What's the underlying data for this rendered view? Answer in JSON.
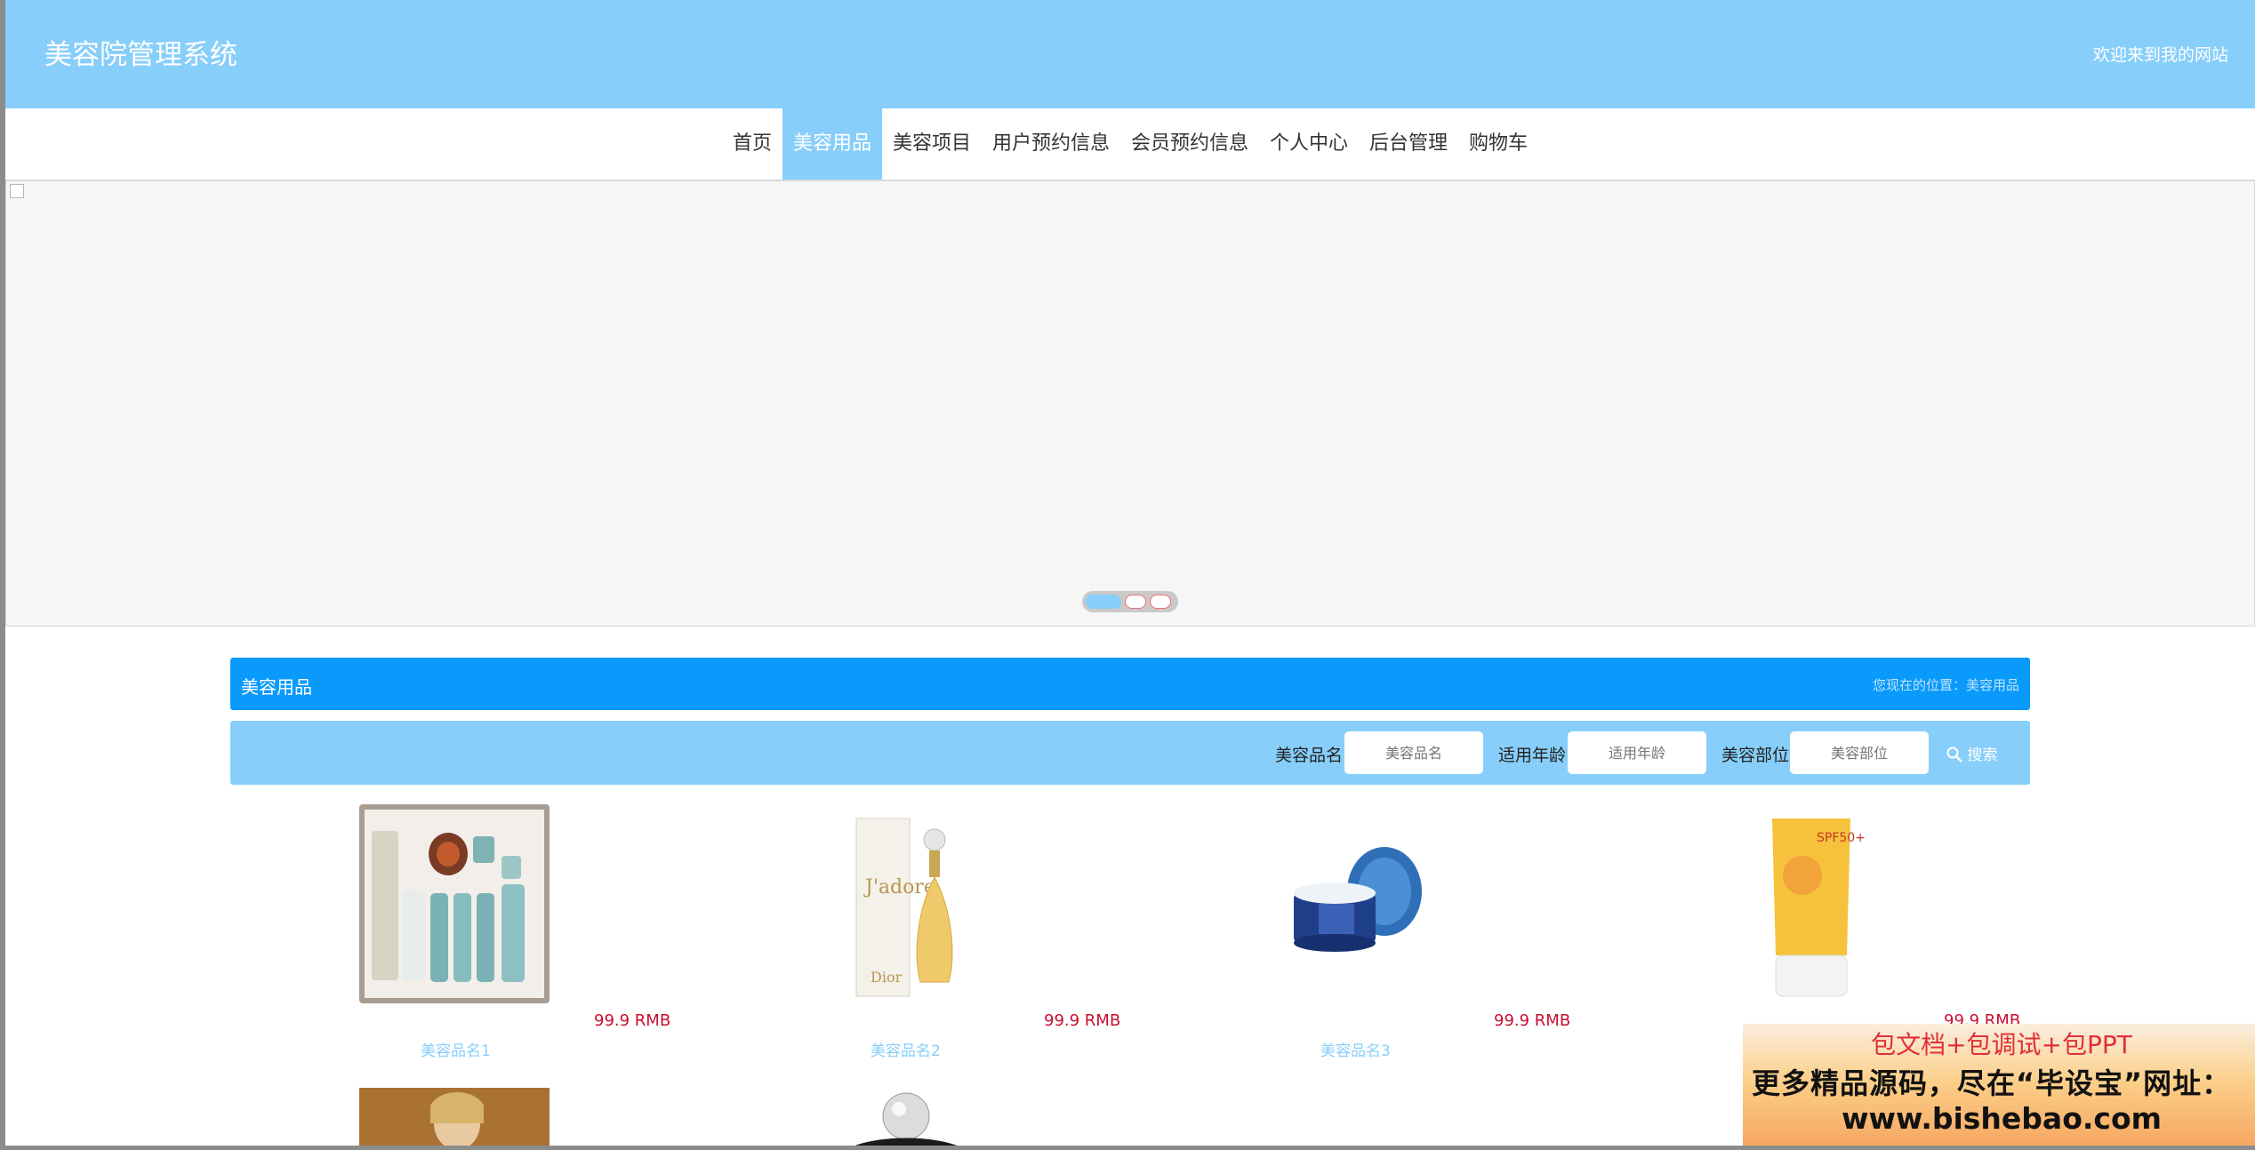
{
  "header": {
    "title": "美容院管理系统",
    "welcome": "欢迎来到我的网站"
  },
  "nav": {
    "items": [
      {
        "label": "首页",
        "active": false
      },
      {
        "label": "美容用品",
        "active": true
      },
      {
        "label": "美容项目",
        "active": false
      },
      {
        "label": "用户预约信息",
        "active": false
      },
      {
        "label": "会员预约信息",
        "active": false
      },
      {
        "label": "个人中心",
        "active": false
      },
      {
        "label": "后台管理",
        "active": false
      },
      {
        "label": "购物车",
        "active": false
      }
    ]
  },
  "carousel": {
    "slide_count": 3,
    "active_index": 0
  },
  "section": {
    "title": "美容用品",
    "breadcrumb": "您现在的位置：美容用品"
  },
  "search": {
    "name_label": "美容品名",
    "name_placeholder": "美容品名",
    "age_label": "适用年龄",
    "age_placeholder": "适用年龄",
    "part_label": "美容部位",
    "part_placeholder": "美容部位",
    "button_label": "搜索",
    "button_icon": "search-icon"
  },
  "products": [
    {
      "name": "美容品名1",
      "price": "99.9 RMB",
      "image": "skincare-set-image"
    },
    {
      "name": "美容品名2",
      "price": "99.9 RMB",
      "image": "perfume-bottle-image"
    },
    {
      "name": "美容品名3",
      "price": "99.9 RMB",
      "image": "cream-jar-image"
    },
    {
      "name": "",
      "price": "99.9 RMB",
      "image": "sunscreen-tube-image"
    }
  ],
  "more_products": [
    {
      "image": "portrait-product-image"
    },
    {
      "image": "crystal-bottle-image"
    }
  ],
  "ad": {
    "line1": "包文档+包调试+包PPT",
    "line2": "更多精品源码，尽在“毕设宝”网址：",
    "line3": "www.bishebao.com"
  },
  "colors": {
    "header_bg": "#87cefa",
    "section_bar": "#0a9afb",
    "price": "#c8102e",
    "product_name": "#87cefa"
  }
}
